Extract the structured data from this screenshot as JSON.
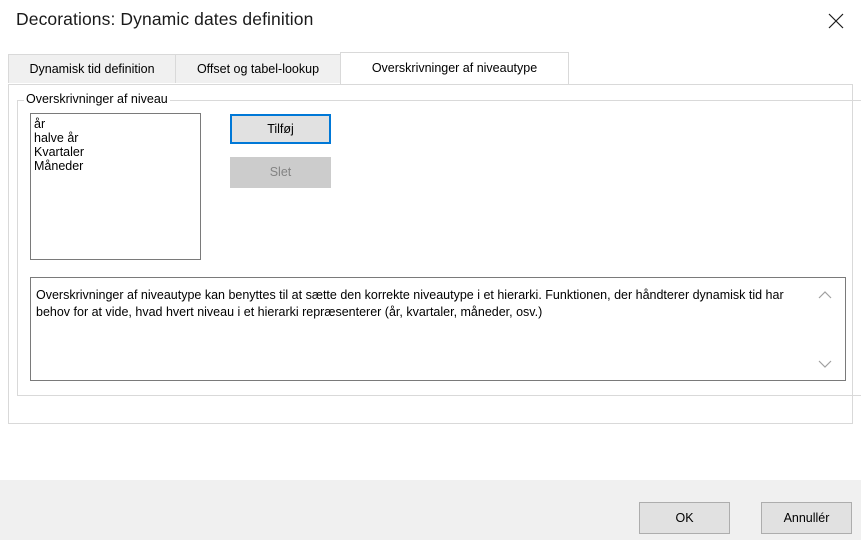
{
  "window": {
    "title": "Decorations: Dynamic dates definition",
    "close_icon": "close-icon"
  },
  "tabs": [
    {
      "label": "Dynamisk tid definition",
      "active": false
    },
    {
      "label": "Offset og tabel-lookup",
      "active": false
    },
    {
      "label": "Overskrivninger af niveautype",
      "active": true
    }
  ],
  "group": {
    "legend": "Overskrivninger af niveau",
    "levels": [
      "år",
      "halve år",
      "Kvartaler",
      "Måneder"
    ],
    "add_label": "Tilføj",
    "delete_label": "Slet",
    "description": "Overskrivninger af niveautype kan benyttes til at sætte den korrekte niveautype i et hierarki. Funktionen, der håndterer dynamisk tid har behov for at vide, hvad hvert niveau i et hierarki repræsenterer (år, kvartaler, måneder, osv.)"
  },
  "footer": {
    "ok_label": "OK",
    "cancel_label": "Annullér"
  },
  "colors": {
    "accent": "#0078d7",
    "disabled_bg": "#cccccc",
    "disabled_text": "#838383",
    "footer_bg": "#f0f0f0"
  }
}
